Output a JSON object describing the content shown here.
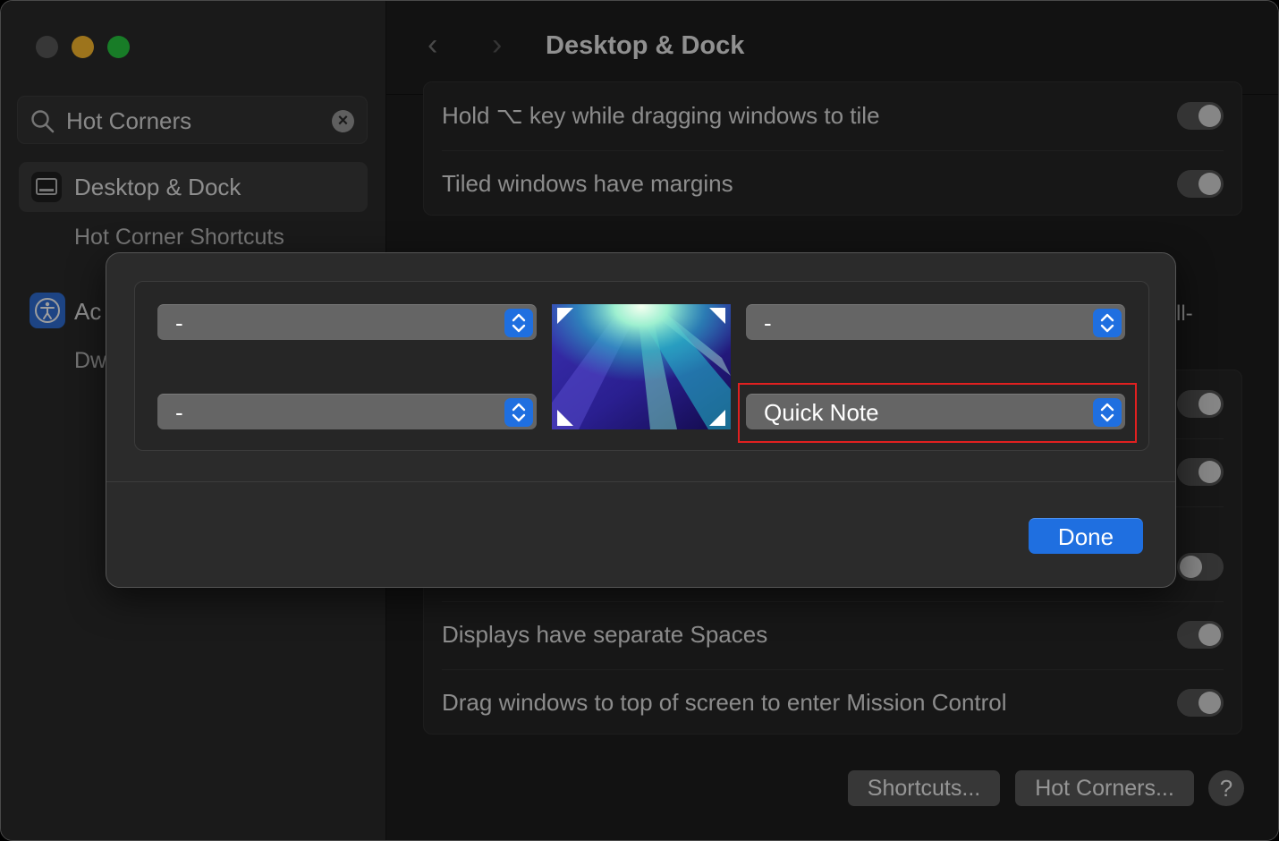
{
  "window": {
    "title": "Desktop & Dock"
  },
  "search": {
    "value": "Hot Corners"
  },
  "sidebar": {
    "items": [
      {
        "label": "Desktop & Dock",
        "icon": "desktop-dock-icon"
      },
      {
        "label": "Hot Corner Shortcuts"
      },
      {
        "label": "Ac",
        "icon": "accessibility-icon"
      },
      {
        "label": "Dw"
      }
    ]
  },
  "settings": {
    "top_group": [
      {
        "label": "Hold ⌥ key while dragging windows to tile"
      },
      {
        "label": "Tiled windows have margins"
      }
    ],
    "bottom_group": [
      {
        "label": "Displays have separate Spaces"
      },
      {
        "label": "Drag windows to top of screen to enter Mission Control"
      }
    ],
    "stray_text": "ll-"
  },
  "footer_buttons": {
    "shortcuts": "Shortcuts...",
    "hot_corners": "Hot Corners...",
    "help": "?"
  },
  "hot_corners_sheet": {
    "top_left": "-",
    "top_right": "-",
    "bottom_left": "-",
    "bottom_right": "Quick Note",
    "done": "Done"
  },
  "colors": {
    "accent": "#1f6fe0",
    "highlight": "#e02020"
  }
}
